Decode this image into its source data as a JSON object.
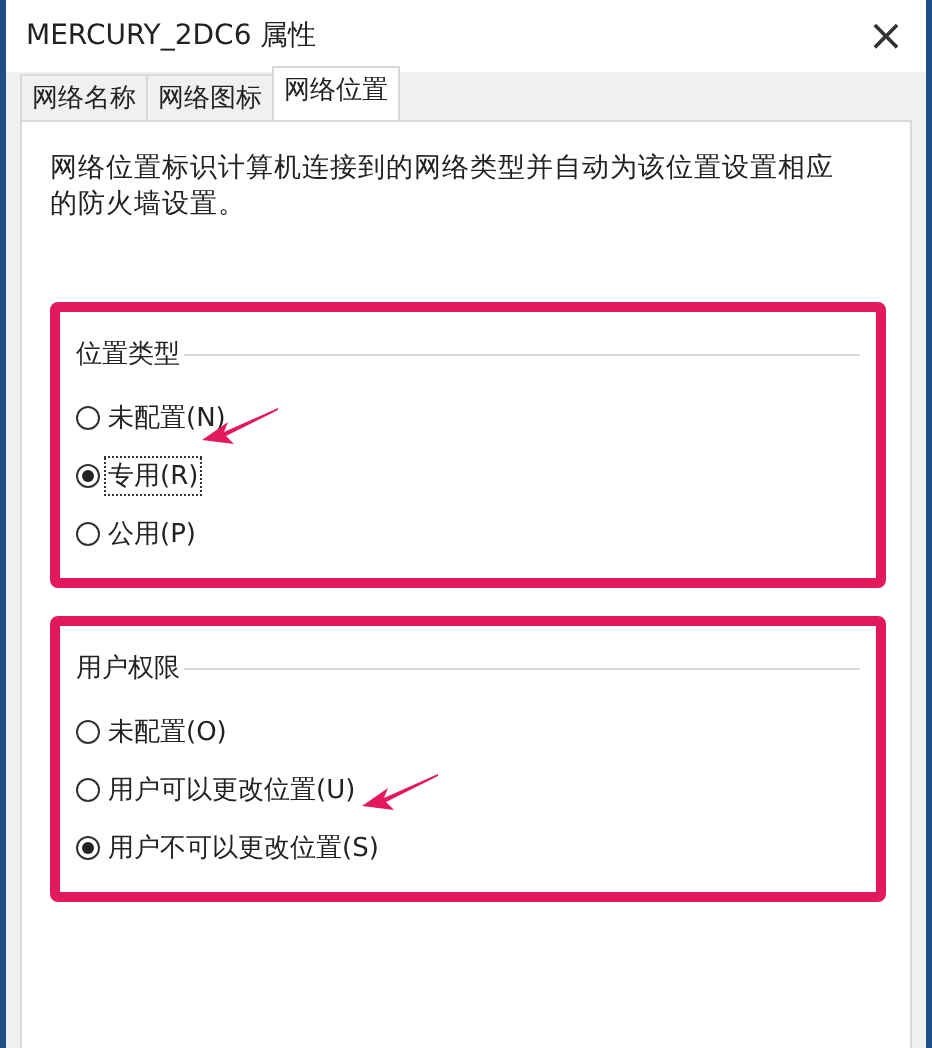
{
  "window": {
    "title": "MERCURY_2DC6 属性",
    "close": "×"
  },
  "tabs": [
    {
      "label": "网络名称",
      "selected": false
    },
    {
      "label": "网络图标",
      "selected": false
    },
    {
      "label": "网络位置",
      "selected": true
    }
  ],
  "description": "网络位置标识计算机连接到的网络类型并自动为该位置设置相应的防火墙设置。",
  "groups": [
    {
      "title": "位置类型",
      "options": [
        {
          "label": "未配置(N)",
          "selected": false,
          "focused": false
        },
        {
          "label": "专用(R)",
          "selected": true,
          "focused": true
        },
        {
          "label": "公用(P)",
          "selected": false,
          "focused": false
        }
      ]
    },
    {
      "title": "用户权限",
      "options": [
        {
          "label": "未配置(O)",
          "selected": false,
          "focused": false
        },
        {
          "label": "用户可以更改位置(U)",
          "selected": false,
          "focused": false
        },
        {
          "label": "用户不可以更改位置(S)",
          "selected": true,
          "focused": false
        }
      ]
    }
  ]
}
